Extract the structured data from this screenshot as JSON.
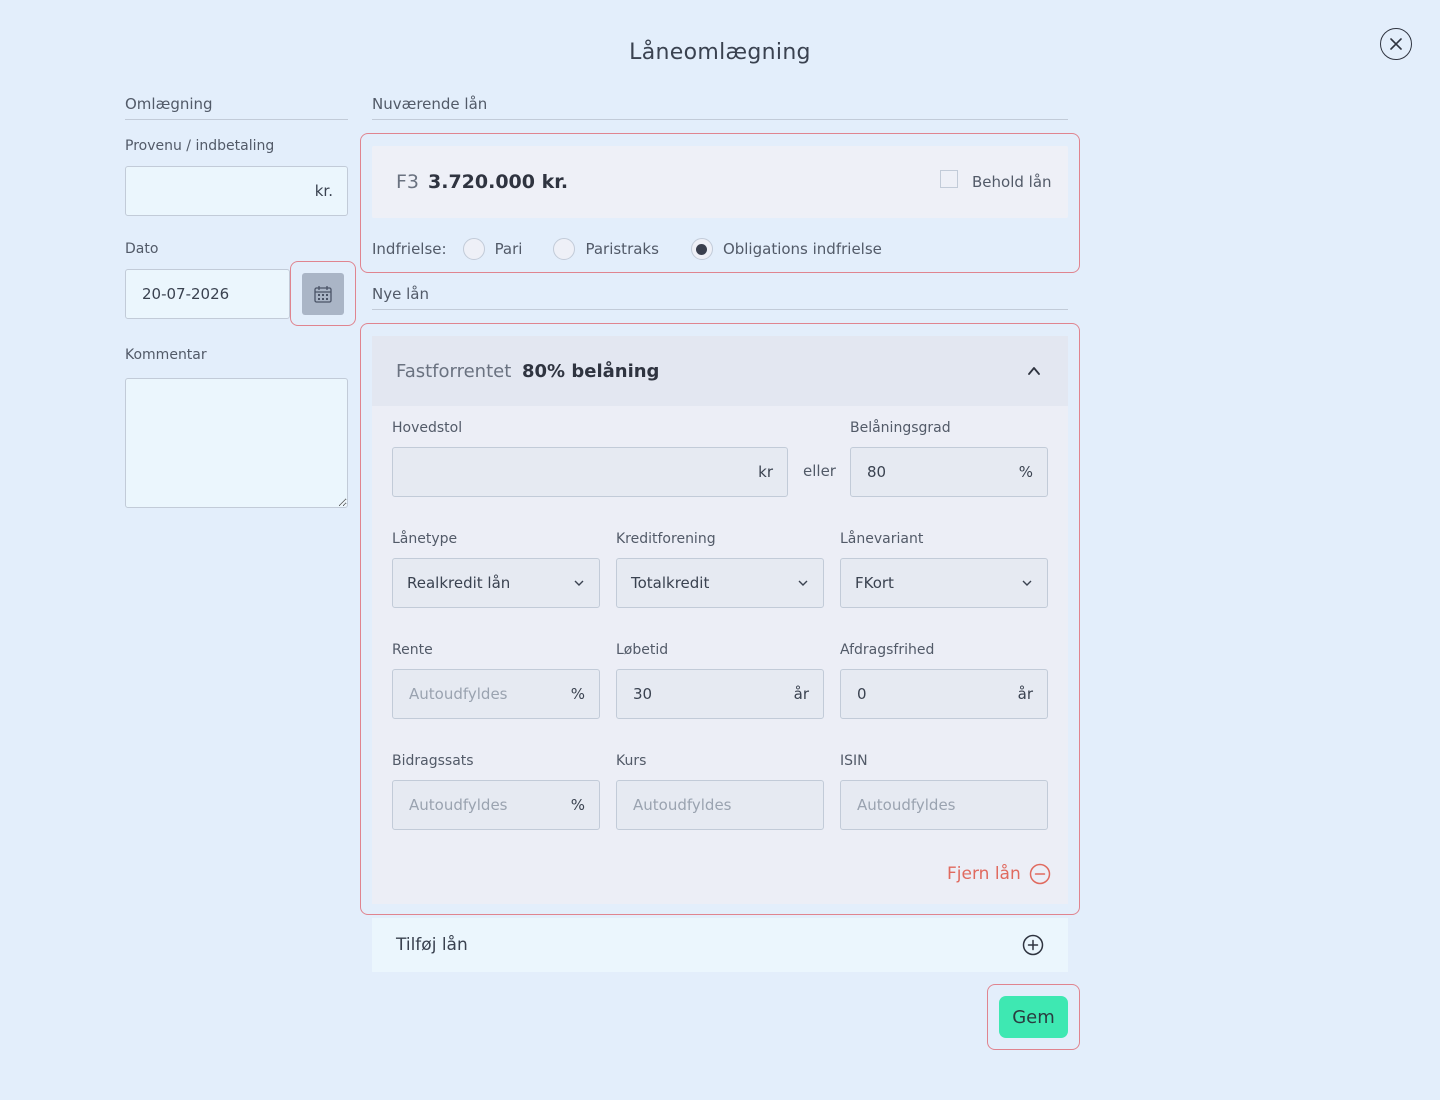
{
  "dialog": {
    "title": "Låneomlægning"
  },
  "left": {
    "section_label": "Omlægning",
    "proceeds": {
      "label": "Provenu / indbetaling",
      "value": "",
      "unit": "kr."
    },
    "date": {
      "label": "Dato",
      "value": "20-07-2026"
    },
    "comment": {
      "label": "Kommentar",
      "value": ""
    }
  },
  "current_loans": {
    "section_label": "Nuværende lån",
    "loan": {
      "code": "F3",
      "amount": "3.720.000 kr.",
      "keep_label": "Behold lån",
      "keep_checked": false
    },
    "redemption": {
      "label": "Indfrielse:",
      "options": [
        "Pari",
        "Paristraks",
        "Obligations indfrielse"
      ],
      "selected": "Obligations indfrielse"
    }
  },
  "new_loans": {
    "section_label": "Nye lån",
    "loan": {
      "type_label": "Fastforrentet",
      "ltv_title": "80% belåning",
      "principal": {
        "label": "Hovedstol",
        "value": "",
        "unit": "kr"
      },
      "or_label": "eller",
      "ltv": {
        "label": "Belåningsgrad",
        "value": "80",
        "unit": "%"
      },
      "loan_type": {
        "label": "Lånetype",
        "value": "Realkredit lån"
      },
      "institution": {
        "label": "Kreditforening",
        "value": "Totalkredit"
      },
      "variant": {
        "label": "Lånevariant",
        "value": "FKort"
      },
      "rate": {
        "label": "Rente",
        "placeholder": "Autoudfyldes",
        "unit": "%"
      },
      "term": {
        "label": "Løbetid",
        "value": "30",
        "unit": "år"
      },
      "io_period": {
        "label": "Afdragsfrihed",
        "value": "0",
        "unit": "år"
      },
      "fee_rate": {
        "label": "Bidragssats",
        "placeholder": "Autoudfyldes",
        "unit": "%"
      },
      "price": {
        "label": "Kurs",
        "placeholder": "Autoudfyldes"
      },
      "isin": {
        "label": "ISIN",
        "placeholder": "Autoudfyldes"
      },
      "remove_label": "Fjern lån"
    },
    "add_label": "Tilføj lån"
  },
  "actions": {
    "save_label": "Gem"
  },
  "colors": {
    "background": "#e3eefb",
    "accent": "#3ee8b2",
    "highlight": "#e0848f",
    "danger": "#e06a5f"
  }
}
